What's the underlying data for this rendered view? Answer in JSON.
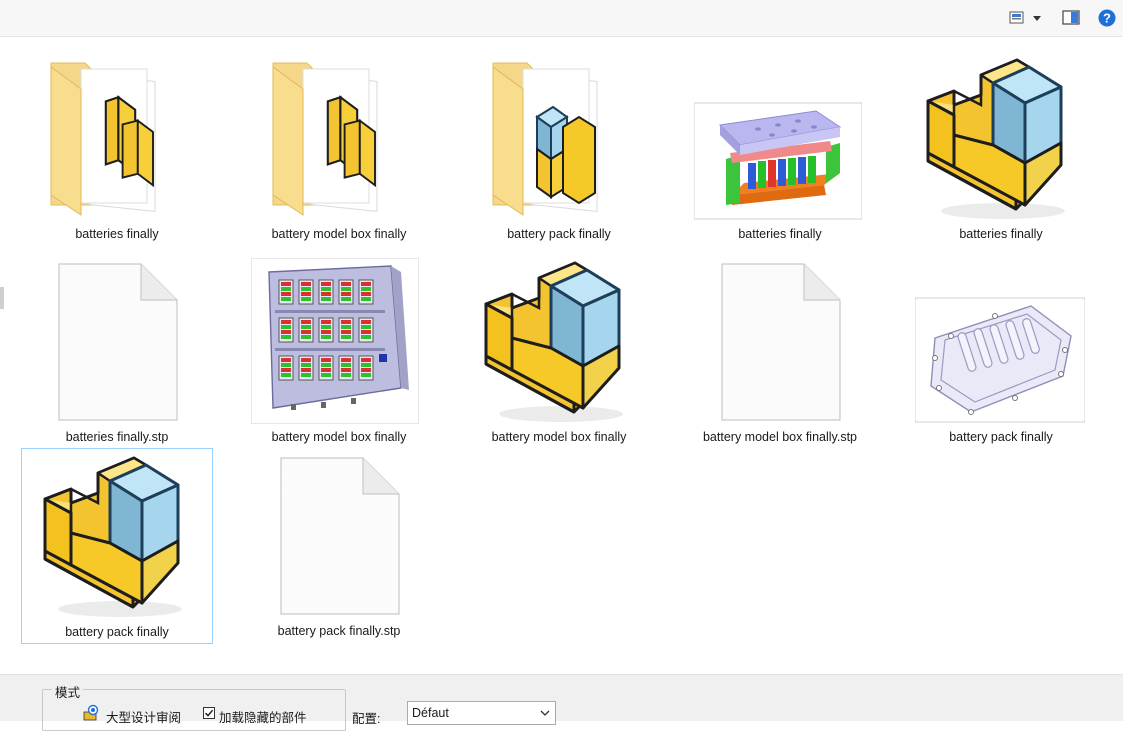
{
  "toolbar": {
    "view_icon": "view-options-icon",
    "dropdown_icon": "chevron-down-icon",
    "preview_icon": "preview-pane-icon",
    "help_icon": "help-icon",
    "help_glyph": "?",
    "accent": "#1e6fd9"
  },
  "files": [
    {
      "label": "batteries finally",
      "icon": "assembly-folder-icon"
    },
    {
      "label": "battery model box finally",
      "icon": "assembly-folder-icon"
    },
    {
      "label": "battery pack finally",
      "icon": "assembly-folder-icon"
    },
    {
      "label": "batteries finally",
      "icon": "battery-assembly-thumbnail"
    },
    {
      "label": "batteries finally",
      "icon": "part-file-icon"
    },
    {
      "label": "batteries finally.stp",
      "icon": "blank-file-icon"
    },
    {
      "label": "battery model box finally",
      "icon": "battery-box-thumbnail"
    },
    {
      "label": "battery model box finally",
      "icon": "part-file-icon"
    },
    {
      "label": "battery model box finally.stp",
      "icon": "blank-file-icon"
    },
    {
      "label": "battery pack finally",
      "icon": "battery-pack-thumbnail"
    },
    {
      "label": "battery pack finally",
      "icon": "part-file-icon"
    },
    {
      "label": "battery pack finally.stp",
      "icon": "blank-file-icon"
    }
  ],
  "bottom_panel": {
    "mode_legend": "模式",
    "large_design_review": "大型设计审阅",
    "load_hidden_label": "加载隐藏的部件",
    "load_hidden_checked": true,
    "config_label": "配置:",
    "config_value": "Défaut"
  }
}
